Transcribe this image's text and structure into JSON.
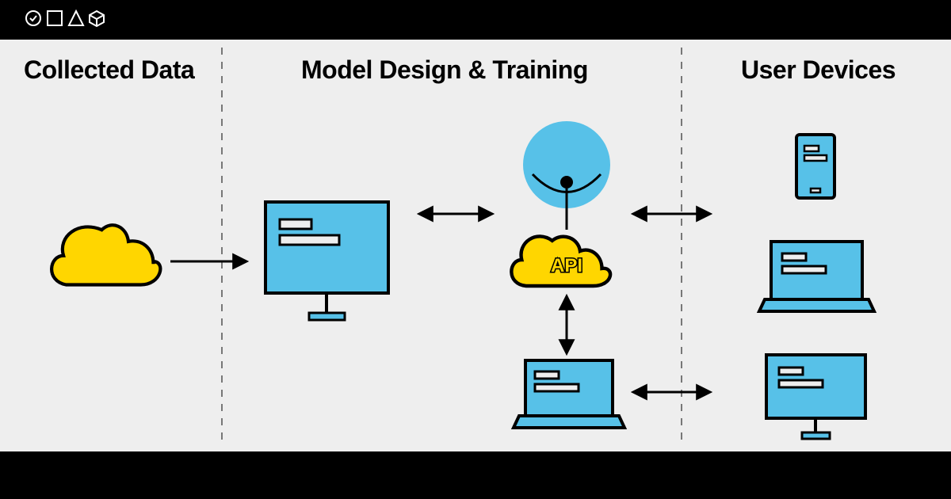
{
  "columns": {
    "left": {
      "title": "Collected Data"
    },
    "middle": {
      "title": "Model Design & Training"
    },
    "right": {
      "title": "User Devices"
    }
  },
  "api_label": "API",
  "colors": {
    "yellow": "#ffd600",
    "blue": "#57c1e8",
    "black": "#000000",
    "bg": "#eeeeee"
  },
  "icons": {
    "cloud_data": "cloud",
    "monitor": "desktop-monitor-with-code",
    "laptop": "laptop-with-code",
    "phone": "phone-with-code",
    "api_cloud": "cloud-with-api-label",
    "agent": "agent-circle"
  },
  "flows": [
    {
      "from": "collected-data-cloud",
      "to": "design-monitor",
      "bidirectional": false
    },
    {
      "from": "design-monitor",
      "to": "api-stack",
      "bidirectional": true
    },
    {
      "from": "api-stack",
      "to": "user-laptop",
      "bidirectional": true
    },
    {
      "from": "api-stack",
      "to": "engineering-laptop",
      "bidirectional": true
    },
    {
      "from": "engineering-laptop",
      "to": "user-desktop",
      "bidirectional": true
    }
  ]
}
